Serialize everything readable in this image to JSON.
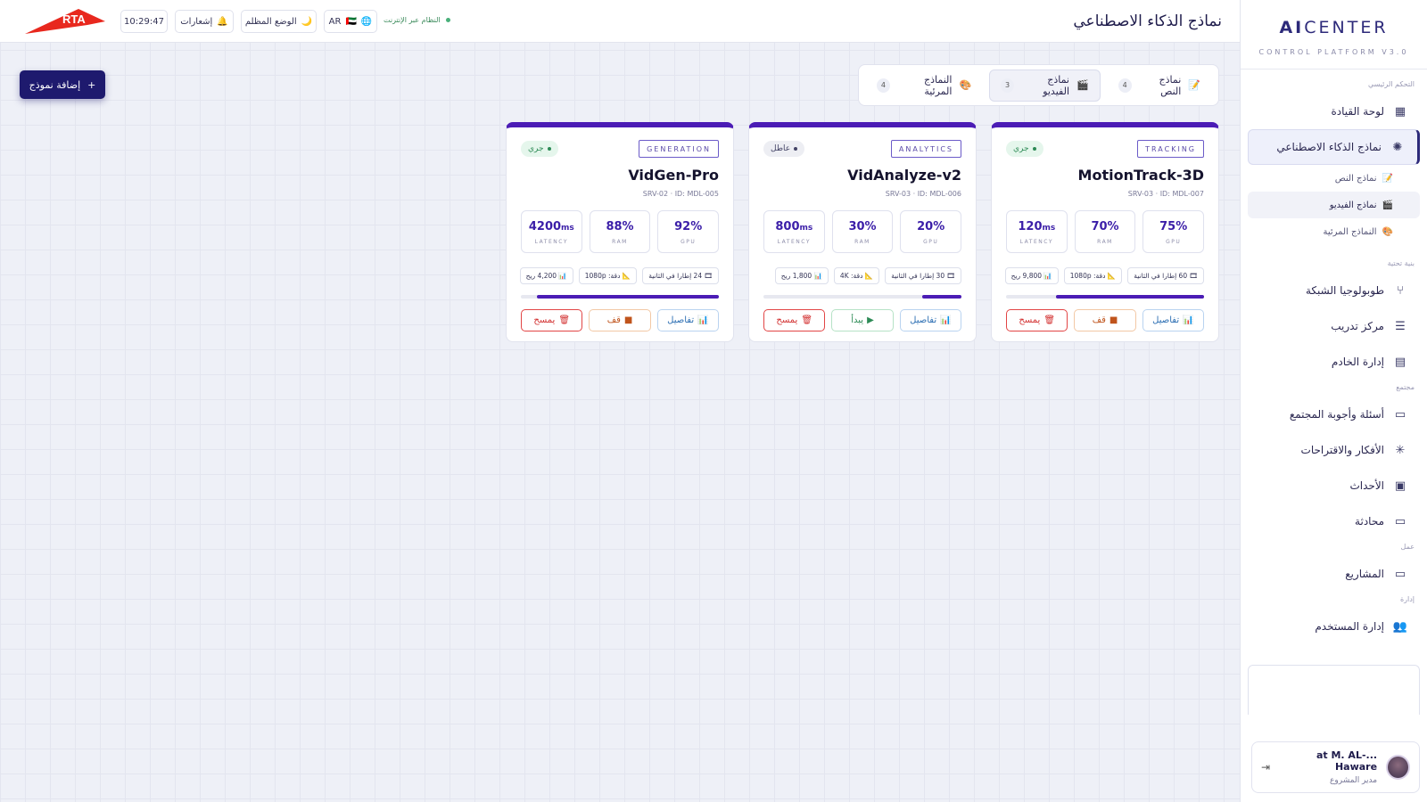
{
  "brand": {
    "name_bold": "AI",
    "name_rest": "CENTER",
    "subtitle": "CONTROL PLATFORM V3.0",
    "logo_text": "RTA"
  },
  "sidebar": {
    "sections": {
      "main": "التحكم الرئيسي",
      "infra": "بنية تحتية",
      "community": "مجتمع",
      "work": "عمل",
      "admin": "إدارة"
    },
    "items": {
      "dashboard": "لوحة القيادة",
      "ai_models": "نماذج الذكاء الاصطناعي",
      "text_models": "نماذج النص",
      "video_models": "نماذج الفيديو",
      "visual_models": "النماذج المرئية",
      "network": "طوبولوجيا الشبكة",
      "training": "مركز تدريب",
      "server": "إدارة الخادم",
      "qa": "أسئلة وأجوبة المجتمع",
      "ideas": "الأفكار والاقتراحات",
      "events": "الأحداث",
      "chat": "محادثة",
      "projects": "المشاريع",
      "users": "إدارة المستخدم"
    },
    "user": {
      "name": "...at M. AL-Haware",
      "role": "مدير المشروع"
    }
  },
  "topbar": {
    "title": "نماذج الذكاء الاصطناعي",
    "time": "10:29:47",
    "notifications": "إشعارات",
    "dark_mode": "الوضع المظلم",
    "lang": "AR",
    "status": "النظام عبر الإنترنت"
  },
  "add_button": "إضافة نموذج",
  "tabs": [
    {
      "label": "نماذج النص",
      "count": "4",
      "icon": "📝"
    },
    {
      "label": "نماذج الفيديو",
      "count": "3",
      "icon": "🎬"
    },
    {
      "label": "النماذج المرئية",
      "count": "4",
      "icon": "🎨"
    }
  ],
  "cards": [
    {
      "badge": "TRACKING",
      "state": "جري",
      "name": "MotionTrack-3D",
      "id": "SRV-03 · ID: MDL-007",
      "gpu": "75%",
      "ram": "70%",
      "latency": "120",
      "latency_unit": "ms",
      "fps": "60 إطارا في الثانية",
      "res": "دقة: 1080p",
      "cost": "9,800 ريح",
      "progress": 0.75,
      "details": "تفاصيل",
      "stop": "قف",
      "delete": "يمسح"
    },
    {
      "badge": "ANALYTICS",
      "state": "عاطل",
      "name": "VidAnalyze-v2",
      "id": "SRV-03 · ID: MDL-006",
      "gpu": "20%",
      "ram": "30%",
      "latency": "800",
      "latency_unit": "ms",
      "fps": "30 إطارا في الثانية",
      "res": "دقة: 4K",
      "cost": "1,800 ريح",
      "progress": 0.2,
      "details": "تفاصيل",
      "start": "يبدأ",
      "delete": "يمسح"
    },
    {
      "badge": "GENERATION",
      "state": "جري",
      "name": "VidGen-Pro",
      "id": "SRV-02 · ID: MDL-005",
      "gpu": "92%",
      "ram": "88%",
      "latency": "4200",
      "latency_unit": "ms",
      "fps": "24 إطارا في الثانية",
      "res": "دقة: 1080p",
      "cost": "4,200 ريح",
      "progress": 0.92,
      "details": "تفاصيل",
      "stop": "قف",
      "delete": "يمسح"
    }
  ],
  "stat_labels": {
    "gpu": "GPU",
    "ram": "RAM",
    "latency": "LATENCY"
  },
  "colors": {
    "accent": "#4b1cb5",
    "brand": "#1e1a6e",
    "running": "#2c8a55",
    "delete": "#d22f2f"
  }
}
